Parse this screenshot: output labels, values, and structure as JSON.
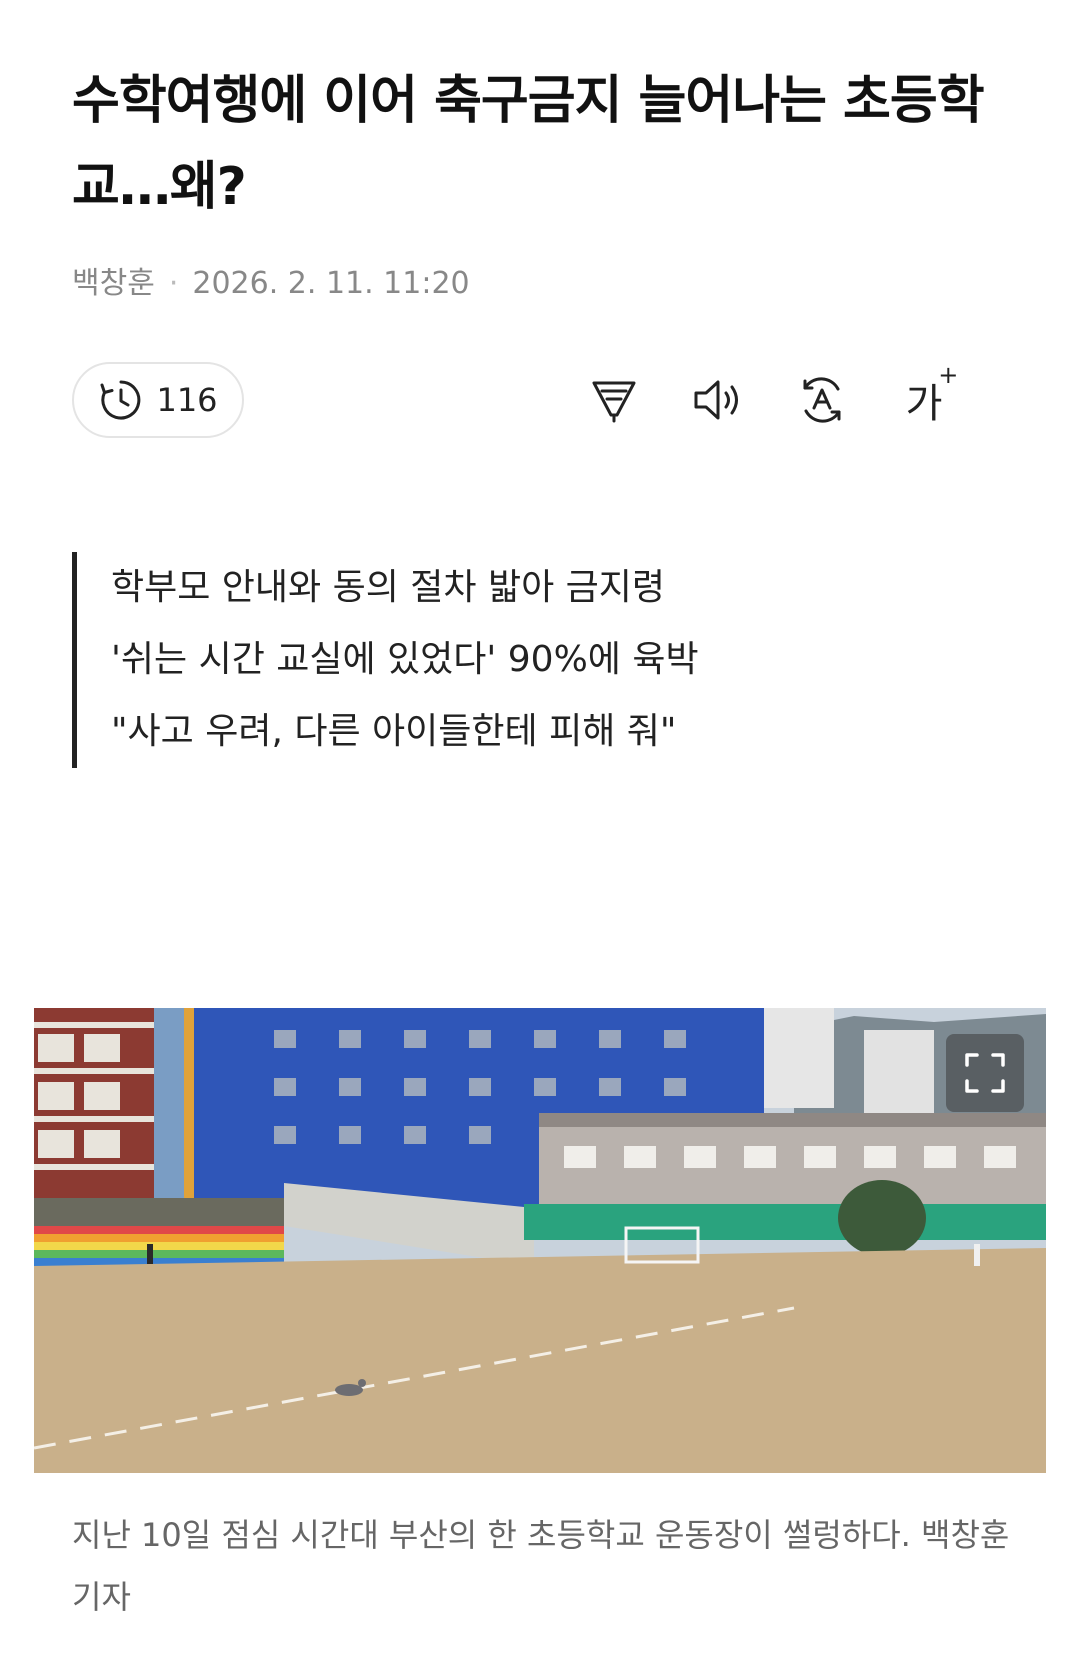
{
  "article": {
    "headline": "수학여행에 이어 축구금지 늘어나는 초등학교…왜?",
    "author": "백창훈",
    "datetime": "2026. 2. 11. 11:20"
  },
  "toolbar": {
    "read_count": "116",
    "font_size_label": "가",
    "font_size_plus": "+",
    "icons": [
      "history-clock-icon",
      "summary-filter-icon",
      "speaker-icon",
      "translate-icon",
      "font-size-icon"
    ]
  },
  "summary": {
    "lines": [
      "학부모 안내와 동의 절차 밟아 금지령",
      "'쉬는 시간 교실에 있었다' 90%에 육박",
      "\"사고 우려, 다른 아이들한테 피해 줘\""
    ]
  },
  "photo": {
    "caption": "지난 10일 점심 시간대 부산의 한 초등학교 운동장이 썰렁하다. 백창훈 기자"
  },
  "colors": {
    "text": "#111111",
    "meta": "#888888",
    "caption": "#666666",
    "border": "#e4e4e4"
  }
}
